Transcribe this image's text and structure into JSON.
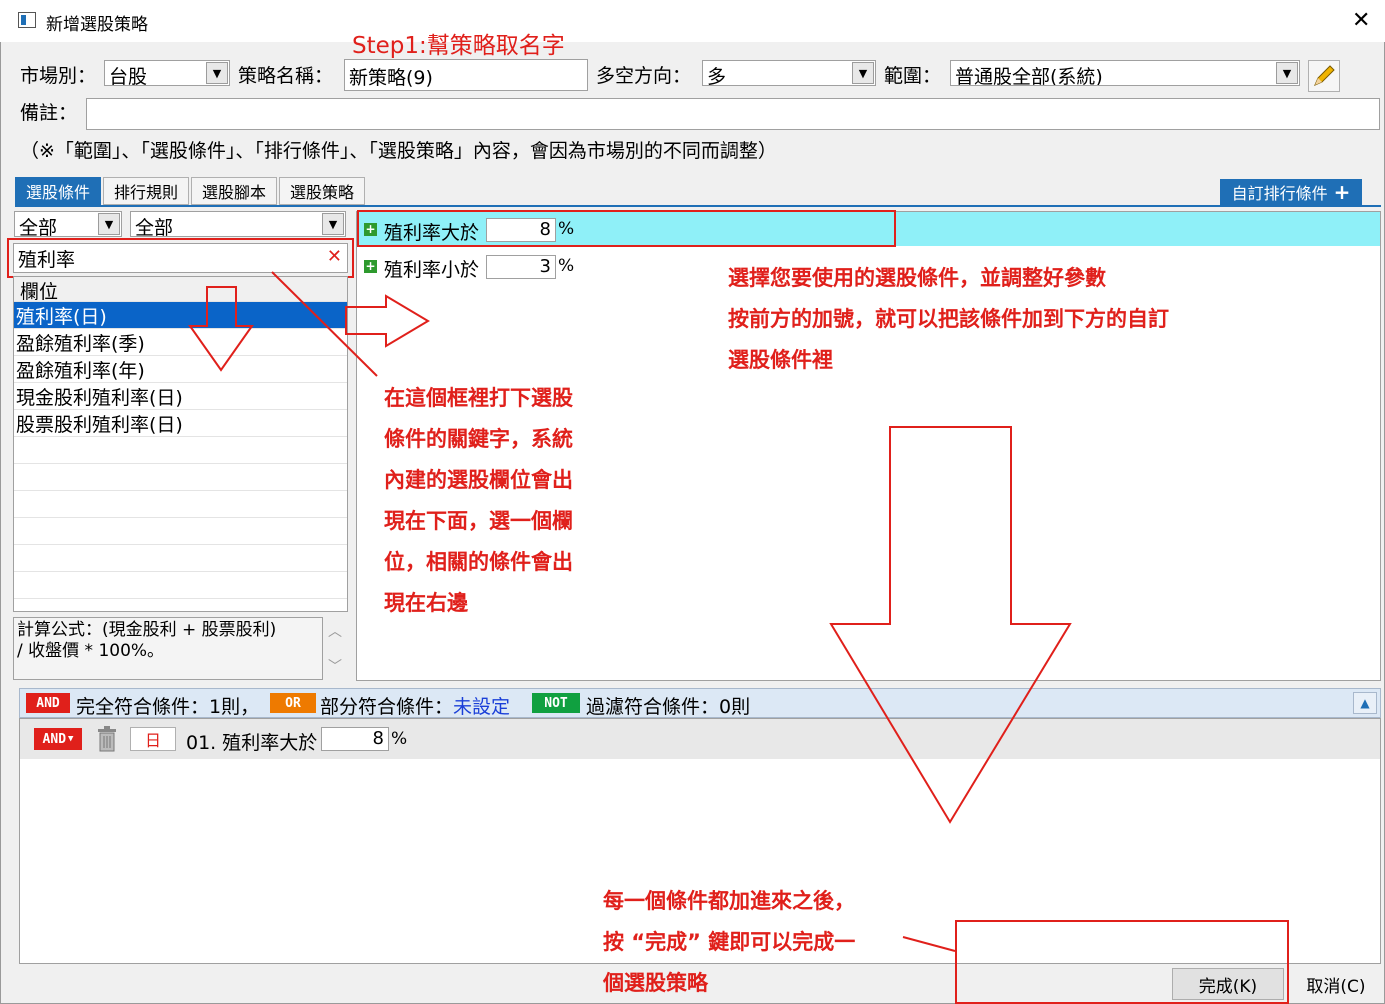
{
  "window": {
    "title": "新增選股策略",
    "close_glyph": "✕"
  },
  "annotations": {
    "step1": "Step1:幫策略取名字",
    "keyword_hint": [
      "在這個框裡打下選股",
      "條件的關鍵字，系統",
      "內建的選股欄位會出",
      "現在下面，選一個欄",
      "位，相關的條件會出",
      "現在右邊"
    ],
    "condition_hint": [
      "選擇您要使用的選股條件，並調整好參數",
      "按前方的加號，就可以把該條件加到下方的自訂",
      "選股條件裡"
    ],
    "finish_hint": [
      "每一個條件都加進來之後，",
      "按 “完成” 鍵即可以完成一",
      "個選股策略"
    ]
  },
  "form": {
    "market_label": "市場別：",
    "market_value": "台股",
    "strategy_name_label": "策略名稱：",
    "strategy_name_value": "新策略(9)",
    "direction_label": "多空方向：",
    "direction_value": "多",
    "scope_label": "範圍：",
    "scope_value": "普通股全部(系統)",
    "note_label": "備註：",
    "note_value": "",
    "notice": "（※「範圍」、「選股條件」、「排行條件」、「選股策略」內容，會因為市場別的不同而調整）"
  },
  "tabs": [
    "選股條件",
    "排行規則",
    "選股腳本",
    "選股策略"
  ],
  "custom_rank_button": "自訂排行條件",
  "filter": {
    "combo1": "全部",
    "combo2": "全部",
    "search_value": "殖利率",
    "column_header": "欄位",
    "items": [
      "殖利率(日)",
      "盈餘殖利率(季)",
      "盈餘殖利率(年)",
      "現金股利殖利率(日)",
      "股票股利殖利率(日)"
    ],
    "formula_line1": "計算公式：(現金股利 + 股票股利)",
    "formula_line2": "/ 收盤價 * 100%。"
  },
  "conditions": [
    {
      "label": "殖利率大於",
      "value": "8",
      "unit": "%"
    },
    {
      "label": "殖利率小於",
      "value": "3",
      "unit": "%"
    }
  ],
  "summary": {
    "and_badge": "AND",
    "and_text": "完全符合條件：1則，",
    "or_badge": "OR",
    "or_text": "部分符合條件：",
    "or_value": "未設定",
    "not_badge": "NOT",
    "not_text": "過濾符合條件：0則"
  },
  "selected_condition": {
    "badge": "AND",
    "period": "日",
    "label": "01. 殖利率大於",
    "value": "8",
    "unit": "%"
  },
  "buttons": {
    "finish": "完成(K)",
    "cancel": "取消(C)"
  },
  "colors": {
    "accent": "#1f6fb6",
    "annotation_red": "#e0201b",
    "highlight": "#8ff0f8",
    "and_red": "#e0201b",
    "or_orange": "#ee7a00",
    "not_green": "#10a040"
  }
}
